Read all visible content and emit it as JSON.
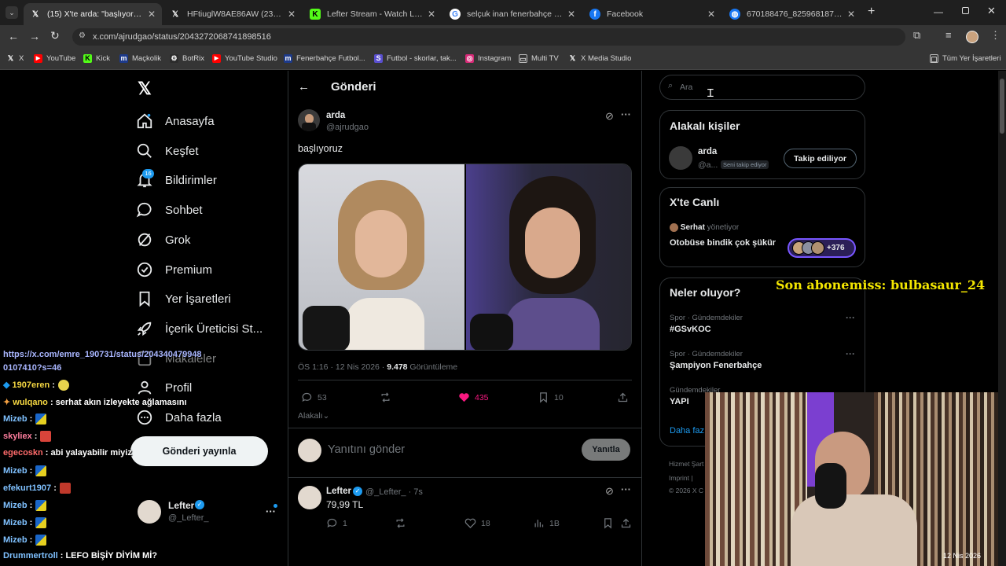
{
  "browser": {
    "tabs": [
      {
        "title": "(15) X'te arda: \"başlıyoruz https",
        "icon": "x-logo-icon",
        "active": true
      },
      {
        "title": "HFtiuglW8AE86AW (2300×1800",
        "icon": "x-logo-icon"
      },
      {
        "title": "Lefter Stream - Watch Live on K",
        "icon": "kick-icon"
      },
      {
        "title": "selçuk inan fenerbahçe - Googl",
        "icon": "google-icon"
      },
      {
        "title": "Facebook",
        "icon": "facebook-icon"
      },
      {
        "title": "670188476_825968187212234_",
        "icon": "globe-icon"
      }
    ],
    "url": "x.com/ajrudgao/status/2043272068741898516",
    "bookmarks": [
      "X",
      "YouTube",
      "Kick",
      "Maçkolik",
      "BotRix",
      "YouTube Studio",
      "Fenerbahçe Futbol...",
      "Futbol - skorlar, tak...",
      "Instagram",
      "Multi TV",
      "X Media Studio"
    ],
    "all_bookmarks": "Tüm Yer İşaretleri"
  },
  "sidebar": {
    "items": [
      {
        "label": "Anasayfa",
        "icon": "home-icon"
      },
      {
        "label": "Keşfet",
        "icon": "search-icon"
      },
      {
        "label": "Bildirimler",
        "icon": "bell-icon",
        "badge": "16"
      },
      {
        "label": "Sohbet",
        "icon": "chat-icon"
      },
      {
        "label": "Grok",
        "icon": "grok-icon"
      },
      {
        "label": "Premium",
        "icon": "premium-icon"
      },
      {
        "label": "Yer İşaretleri",
        "icon": "bookmark-icon"
      },
      {
        "label": "İçerik Üreticisi St...",
        "icon": "rocket-icon"
      },
      {
        "label": "Makaleler",
        "icon": "article-icon"
      },
      {
        "label": "Profil",
        "icon": "profile-icon"
      },
      {
        "label": "Daha fazla",
        "icon": "more-circle-icon"
      }
    ],
    "post_button": "Gönderi yayınla",
    "account": {
      "name": "Lefter",
      "handle": "@_Lefter_"
    }
  },
  "main": {
    "header": "Gönderi",
    "tweet": {
      "name": "arda",
      "handle": "@ajrudgao",
      "text": "başlıyoruz",
      "meta_time": "ÖS 1:16 · 12 Nis 2026 · ",
      "views": "9.478",
      "views_label": " Görüntüleme",
      "replies": "53",
      "likes": "435",
      "bookmarks": "10"
    },
    "relevant_label": "Alakalı",
    "reply_placeholder": "Yanıtını gönder",
    "reply_button": "Yanıtla",
    "reply_tweet": {
      "name": "Lefter",
      "handle": "@_Lefter_ · 7s",
      "text": "79,99 TL",
      "replies": "1",
      "likes": "18",
      "views": "1B"
    }
  },
  "right": {
    "search_placeholder": "Ara",
    "relevant_people_title": "Alakalı kişiler",
    "person": {
      "name": "arda",
      "handle": "@a...",
      "follows_you": "Seni takip ediyor",
      "follow_button": "Takip ediliyor"
    },
    "live_title": "X'te Canlı",
    "live": {
      "host": "Serhat",
      "host_suffix": " yönetiyor",
      "title": "Otobüse bindik çok şükür",
      "count": "+376"
    },
    "trends_title": "Neler oluyor?",
    "trends": [
      {
        "context": "Spor · Gündemdekiler",
        "name": "#GSvKOC"
      },
      {
        "context": "Spor · Gündemdekiler",
        "name": "Şampiyon Fenerbahçe"
      },
      {
        "context": "Gündemdekiler",
        "name": "YAPI"
      }
    ],
    "show_more": "Daha faz",
    "footer1": "Hizmet Şart",
    "footer2": "Imprint  |",
    "footer3": "© 2026 X C"
  },
  "overlay": {
    "sub_alert": "Son abonemiss: bulbasaur_24",
    "link_line1": "https://x.com/emre_190731/status/204340479948",
    "link_line2": "0107410?s=46",
    "chat": [
      {
        "user": "1907eren",
        "msg": " :",
        "color": "#f5d742"
      },
      {
        "user": "wulqano",
        "msg": " : serhat akın izleyekte ağlamasını",
        "color": "#f5d742"
      },
      {
        "user": "Mizeb",
        "msg": " :",
        "color": "#7fc1ff"
      },
      {
        "user": "skyliex",
        "msg": " :",
        "color": "#ff7f9f"
      },
      {
        "user": "egecoskn",
        "msg": " : abi yalayabilir miyiz",
        "color": "#ff6b6b"
      },
      {
        "user": "Mizeb",
        "msg": " :",
        "color": "#7fc1ff"
      },
      {
        "user": "efekurt1907",
        "msg": " :",
        "color": "#7fc1ff"
      },
      {
        "user": "Mizeb",
        "msg": " :",
        "color": "#7fc1ff"
      },
      {
        "user": "Mizeb",
        "msg": " :",
        "color": "#7fc1ff"
      },
      {
        "user": "Mizeb",
        "msg": " :",
        "color": "#7fc1ff"
      },
      {
        "user": "Drummertroll",
        "msg": " : LEFO BİŞİY DİYİM Mİ?",
        "color": "#7fc1ff"
      }
    ],
    "taskbar_date": "12 Nis 2026"
  }
}
